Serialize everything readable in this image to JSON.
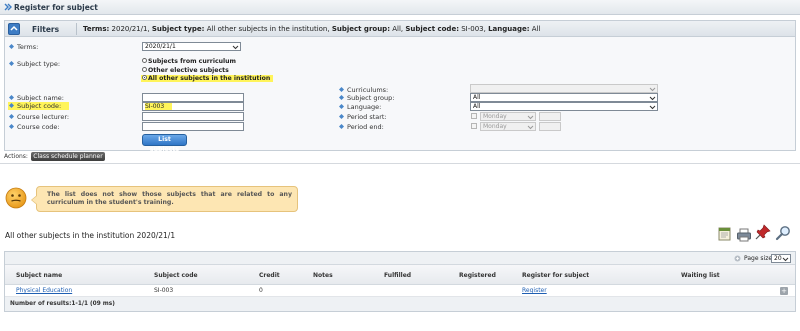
{
  "window": {
    "title": "Register for subject"
  },
  "filters": {
    "header": "Filters",
    "summary": [
      {
        "k": "Terms:",
        "v": " 2020/21/1, "
      },
      {
        "k": "Subject type:",
        "v": " All other subjects in the institution, "
      },
      {
        "k": "Subject group:",
        "v": " All, "
      },
      {
        "k": "Subject code:",
        "v": " SI-003, "
      },
      {
        "k": "Language:",
        "v": " All"
      }
    ],
    "terms_label": "Terms:",
    "terms_value": "2020/21/1",
    "subject_type_label": "Subject type:",
    "subject_type_options": [
      "Subjects from curriculum",
      "Other elective subjects",
      "All other subjects in the institution"
    ],
    "selected_subject_type": "All other subjects in the institution",
    "curriculums_label": "Curriculums:",
    "curriculums_value": "",
    "subject_name_label": "Subject name:",
    "subject_name_value": "",
    "subject_group_label": "Subject group:",
    "subject_group_value": "All",
    "subject_code_label": "Subject code:",
    "subject_code_value": "SI-003",
    "language_label": "Language:",
    "language_value": "All",
    "course_lecturer_label": "Course lecturer:",
    "course_lecturer_value": "",
    "period_start_label": "Period start:",
    "period_start_day": "Monday",
    "course_code_label": "Course code:",
    "course_code_value": "",
    "period_end_label": "Period end:",
    "period_end_day": "Monday",
    "list_button": "List subjects"
  },
  "actions": {
    "label": "Actions:",
    "class_schedule_button": "Class schedule planner"
  },
  "notice": {
    "text": "The list does not show those subjects that are related to any curriculum in the student's training."
  },
  "list": {
    "title": "All other subjects in the institution 2020/21/1",
    "page_size_label": "Page size",
    "page_size_value": "20",
    "columns": [
      "Subject name",
      "Subject code",
      "Credit",
      "Notes",
      "Fulfilled",
      "Registered",
      "Register for subject",
      "Waiting list"
    ],
    "rows": [
      {
        "subject_name": "Physical Education",
        "subject_code": "SI-003",
        "credit": "0",
        "notes": "",
        "fulfilled": "",
        "registered": "",
        "register": "Register",
        "waiting_list": ""
      }
    ],
    "footer": "Number of results:1-1/1 (09 ms)"
  },
  "colors": {
    "accent": "#2f76c6",
    "highlight": "#fff45a",
    "notice_bg": "#fde6b3"
  },
  "icons": [
    "double-chevron-icon",
    "toggle-icon",
    "diamond-bullet-icon",
    "dropdown-caret-icon",
    "smiley-icon",
    "export-icon",
    "print-icon",
    "pin-icon",
    "search-icon",
    "plus-icon"
  ]
}
